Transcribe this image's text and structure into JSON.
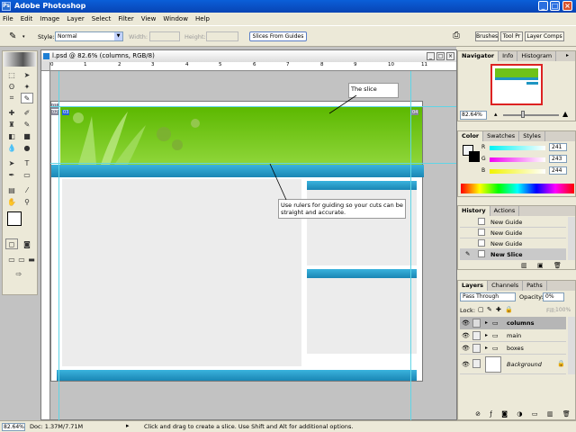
{
  "app": {
    "title": "Adobe Photoshop"
  },
  "menu": [
    "File",
    "Edit",
    "Image",
    "Layer",
    "Select",
    "Filter",
    "View",
    "Window",
    "Help"
  ],
  "options": {
    "style_label": "Style:",
    "style_value": "Normal",
    "width_label": "Width:",
    "height_label": "Height:",
    "slices_button": "Slices From Guides",
    "well_tabs": [
      "Brushes",
      "Tool Pr",
      "Layer Comps"
    ]
  },
  "document": {
    "title": "l.psd @ 82.6% (columns, RGB/8)",
    "ruler_marks": [
      "0",
      "1",
      "2",
      "3",
      "4",
      "5",
      "6",
      "7",
      "8",
      "9",
      "10",
      "11"
    ],
    "slice_labels": [
      "01",
      "02",
      "03",
      "04",
      "05"
    ],
    "callout_slice": "The slice",
    "callout_rulers": "Use rulers for guiding so your cuts can be straight and accurate."
  },
  "navigator": {
    "tabs": [
      "Navigator",
      "Info",
      "Histogram"
    ],
    "zoom": "82.64%"
  },
  "color": {
    "tabs": [
      "Color",
      "Swatches",
      "Styles"
    ],
    "r_label": "R",
    "r_value": "241",
    "g_label": "G",
    "g_value": "243",
    "b_label": "B",
    "b_value": "244"
  },
  "history": {
    "tabs": [
      "History",
      "Actions"
    ],
    "items": [
      "New Guide",
      "New Guide",
      "New Guide",
      "New Slice"
    ]
  },
  "layers": {
    "tabs": [
      "Layers",
      "Channels",
      "Paths"
    ],
    "blend_mode": "Pass Through",
    "opacity_label": "Opacity:",
    "opacity_value": "0%",
    "lock_label": "Lock:",
    "fill_label": "Fill:",
    "fill_value": "100%",
    "items": [
      "columns",
      "main",
      "boxes",
      "Background"
    ]
  },
  "status": {
    "zoom": "82.64%",
    "doc": "Doc: 1.37M/7.71M",
    "hint": "Click and drag to create a slice. Use Shift and Alt for additional options."
  },
  "colors": {
    "title_blue": "#0a5fd8",
    "header_green": "#6ec21a",
    "teal_bar": "#1e95c2",
    "guide_cyan": "#5fd5e6"
  }
}
